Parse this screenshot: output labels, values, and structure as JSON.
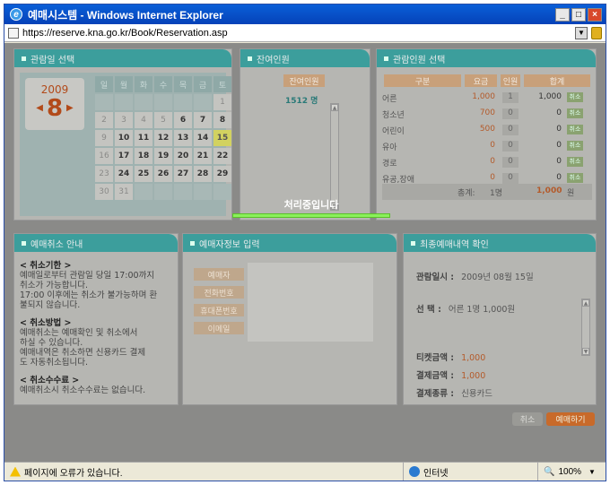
{
  "window": {
    "title": "예매시스템 - Windows Internet Explorer",
    "url": "https://reserve.kna.go.kr/Book/Reservation.asp"
  },
  "panels": {
    "date": "관람일 선택",
    "remain": "잔여인원",
    "people": "관람인원 선택",
    "cancel": "예매취소 안내",
    "booker": "예매자정보 입력",
    "confirm": "최종예매내역 확인"
  },
  "calendar": {
    "year": "2009",
    "month": "8",
    "weekdays": [
      "일",
      "월",
      "화",
      "수",
      "목",
      "금",
      "토"
    ],
    "weeks": [
      [
        "",
        "",
        "",
        "",
        "",
        "",
        "1"
      ],
      [
        "2",
        "3",
        "4",
        "5",
        "6",
        "7",
        "8"
      ],
      [
        "9",
        "10",
        "11",
        "12",
        "13",
        "14",
        "15"
      ],
      [
        "16",
        "17",
        "18",
        "19",
        "20",
        "21",
        "22"
      ],
      [
        "23",
        "24",
        "25",
        "26",
        "27",
        "28",
        "29"
      ],
      [
        "30",
        "31",
        "",
        "",
        "",
        "",
        ""
      ]
    ],
    "selected": "15"
  },
  "remain": {
    "header": "잔여인원",
    "value": "1512 명"
  },
  "tickets": {
    "headers": [
      "구분",
      "요금",
      "인원",
      "합계"
    ],
    "rows": [
      {
        "type": "어른",
        "price": "1,000",
        "qty": "1",
        "sum": "1,000",
        "btn": "취소"
      },
      {
        "type": "청소년",
        "price": "700",
        "qty": "0",
        "sum": "0",
        "btn": "취소"
      },
      {
        "type": "어린이",
        "price": "500",
        "qty": "0",
        "sum": "0",
        "btn": "취소"
      },
      {
        "type": "유아",
        "price": "0",
        "qty": "0",
        "sum": "0",
        "btn": "취소"
      },
      {
        "type": "경로",
        "price": "0",
        "qty": "0",
        "sum": "0",
        "btn": "취소"
      },
      {
        "type": "유공,장애",
        "price": "0",
        "qty": "0",
        "sum": "0",
        "btn": "취소"
      }
    ],
    "total_label": "총계:",
    "total_people": "1명",
    "total_amount": "1,000",
    "total_unit": "원"
  },
  "cancel_info": {
    "s1_title": "< 취소기한 >",
    "s1_l1": "예매일로부터 관람일 당일 17:00까지",
    "s1_l2": "취소가 가능합니다.",
    "s1_l3": "17:00 이후에는 취소가 불가능하며 환",
    "s1_l4": "불되지 않습니다.",
    "s2_title": "< 취소방법 >",
    "s2_l1": "예매취소는 예매확인 및 취소에서",
    "s2_l2": "하실 수 있습니다.",
    "s2_l3": "예매내역은 취소하면 신용카드 결제",
    "s2_l4": "도 자동취소됩니다.",
    "s3_title": "< 취소수수료 >",
    "s3_l1": "예매취소시 취소수수료는 없습니다."
  },
  "booker": {
    "labels": [
      "예매자",
      "전화번호",
      "휴대폰번호",
      "이메일"
    ],
    "processing": "처리중입니다"
  },
  "confirm": {
    "date_label": "관람일시 :",
    "date_value": "2009년 08월 15일",
    "sel_label": "선      택 :",
    "sel_value": "어른 1명 1,000원",
    "ticket_label": "티켓금액 :",
    "ticket_value": "1,000",
    "pay_label": "결제금액 :",
    "pay_value": "1,000",
    "paytype_label": "결제종류 :",
    "paytype_value": "신용카드"
  },
  "actions": {
    "cancel": "취소",
    "book": "예매하기"
  },
  "status": {
    "message": "페이지에 오류가 있습니다.",
    "zone": "인터넷",
    "zoom": "100%"
  }
}
